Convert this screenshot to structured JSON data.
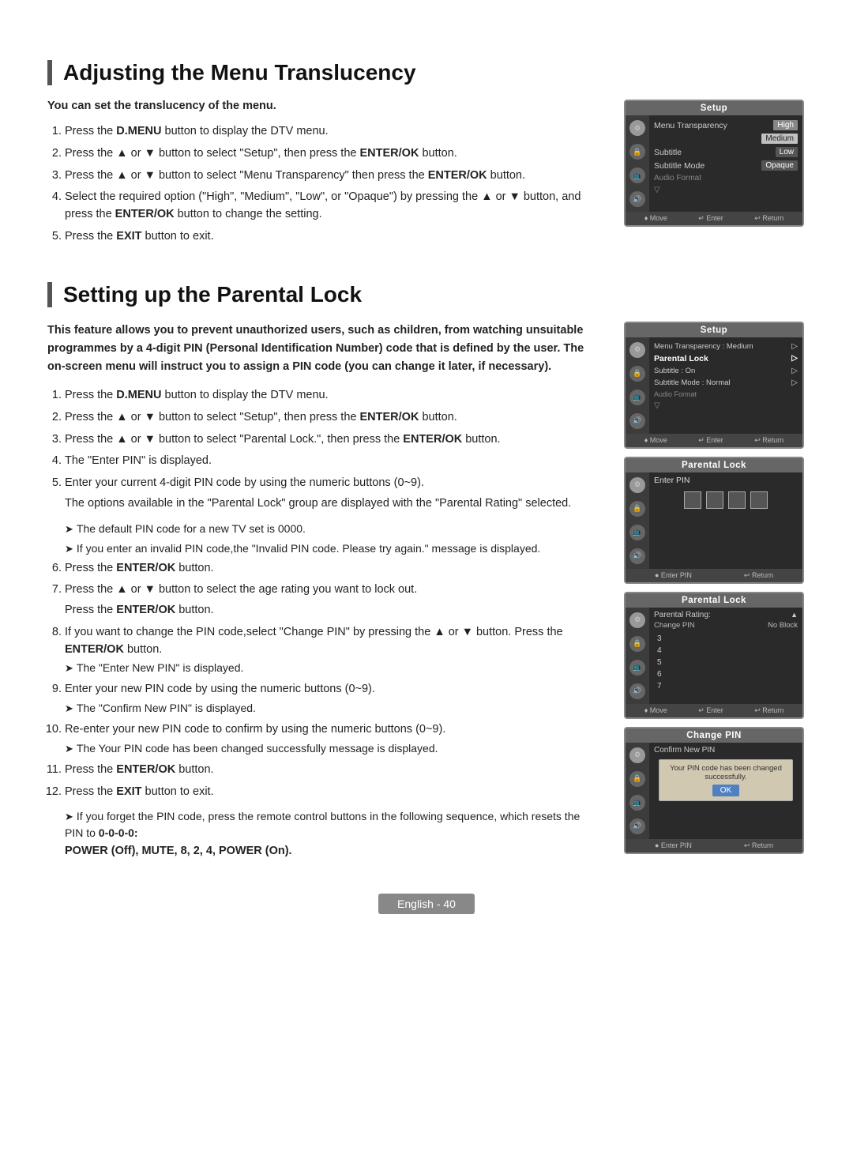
{
  "section1": {
    "title": "Adjusting the Menu Translucency",
    "intro_bold": "You can set the translucency of the menu.",
    "steps": [
      "Press the <b>D.MENU</b> button to display the DTV menu.",
      "Press the ▲ or ▼ button to select \"Setup\", then press the <b>ENTER/OK</b> button.",
      "Press the ▲ or ▼ button to select \"Menu Transparency\" then press the <b>ENTER/OK</b> button.",
      "Select the required option (\"High\", \"Medium\", \"Low\", or \"Opaque\") by pressing the ▲ or ▼ button, and press the <b>ENTER/OK</b> button to change the setting.",
      "Press the <b>EXIT</b> button to exit."
    ],
    "screen": {
      "title": "Setup",
      "rows": [
        {
          "label": "Menu Transparency",
          "val": "High",
          "highlight": false
        },
        {
          "label": "",
          "val": "Medium",
          "highlight": true
        },
        {
          "label": "Subtitle",
          "val": "Low",
          "highlight": false
        },
        {
          "label": "Subtitle Mode",
          "val": "Opaque",
          "highlight": false
        },
        {
          "label": "Audio Format",
          "val": "",
          "highlight": false
        }
      ],
      "footer": [
        "♦ Move",
        "↵ Enter",
        "↩ Return"
      ]
    }
  },
  "section2": {
    "title": "Setting up the Parental Lock",
    "bold_intro": "This feature allows you to prevent unauthorized users, such as children, from watching unsuitable programmes by a 4-digit PIN (Personal Identification Number) code that is defined by the user. The on-screen menu will instruct you to assign a PIN code (you can change it later, if necessary).",
    "steps": [
      "Press the <b>D.MENU</b> button to display the DTV menu.",
      "Press the ▲ or ▼ button to select \"Setup\", then press the <b>ENTER/OK</b> button.",
      "Press the ▲ or ▼ button to select \"Parental Lock.\", then press the <b>ENTER/OK</b> button.",
      "The \"Enter PIN\" is displayed.",
      "Enter your current 4-digit PIN code by using the numeric buttons (0~9).",
      "Press the <b>ENTER/OK</b> button.",
      "Press the ▲ or ▼ button to select the age rating you want to lock out.",
      "If you want to change the PIN code,select \"Change PIN\" by pressing the ▲ or ▼ button. Press the <b>ENTER/OK</b> button.",
      "Enter your new PIN code by using the numeric buttons (0~9).",
      "Re-enter your new PIN code to confirm by using the numeric buttons (0~9).",
      "Press the <b>ENTER/OK</b> button.",
      "Press the <b>EXIT</b> button to exit."
    ],
    "step5_sub": "The options available in the \"Parental Lock\" group are displayed with the \"Parental Rating\" selected.",
    "step5_notes": [
      "The default PIN code for a new TV set is 0000.",
      "If you enter an invalid PIN code,the \"Invalid PIN code. Please try again.\" message is displayed."
    ],
    "step7_sub": "Press the <b>ENTER/OK</b> button.",
    "step8_note": "The \"Enter New PIN\" is displayed.",
    "step9_note": "The \"Confirm New PIN\" is displayed.",
    "step10_note": "The Your PIN code has been changed successfully message is displayed.",
    "final_note": "If you forget the PIN code, press the remote control buttons in the following sequence, which resets the PIN to <b>0-0-0-0:</b>",
    "final_bold": "POWER (Off), MUTE, 8, 2, 4, POWER (On).",
    "screens": [
      {
        "title": "Setup",
        "rows": [
          {
            "label": "Menu Transparency : Medium",
            "val": "▷",
            "highlight": false
          },
          {
            "label": "Parental Lock",
            "val": "▷",
            "highlight": false
          },
          {
            "label": "Subtitle : On",
            "val": "▷",
            "highlight": false
          },
          {
            "label": "Subtitle Mode : Normal",
            "val": "▷",
            "highlight": false
          },
          {
            "label": "Audio Format",
            "val": "",
            "highlight": false
          }
        ],
        "footer": [
          "♦ Move",
          "↵ Enter",
          "↩ Return"
        ]
      },
      {
        "title": "Parental Lock",
        "enter_pin_label": "Enter PIN",
        "pin_boxes": 4,
        "footer": [
          "● Enter PIN",
          "↩ Return"
        ]
      },
      {
        "title": "Parental Lock",
        "parental_rating": "Parental Rating:",
        "change_pin": "Change PIN",
        "ratings": [
          "No Block",
          "3",
          "4",
          "5",
          "6",
          "7"
        ],
        "selected_rating": "No Block",
        "footer": [
          "♦ Move",
          "↵ Enter",
          "↩ Return"
        ]
      },
      {
        "title": "Change PIN",
        "confirm_label": "Confirm New PIN",
        "confirm_message": "Your PIN code has been changed successfully.",
        "ok_label": "OK",
        "footer": [
          "● Enter PIN",
          "↩ Return"
        ]
      }
    ]
  },
  "footer": {
    "label": "English - 40"
  }
}
